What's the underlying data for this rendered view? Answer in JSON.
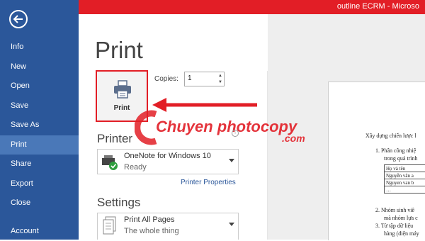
{
  "window": {
    "title": "outline ECRM -  Microso"
  },
  "sidebar": {
    "items": [
      {
        "label": "Info"
      },
      {
        "label": "New"
      },
      {
        "label": "Open"
      },
      {
        "label": "Save"
      },
      {
        "label": "Save As"
      },
      {
        "label": "Print",
        "active": true
      },
      {
        "label": "Share"
      },
      {
        "label": "Export"
      },
      {
        "label": "Close"
      },
      {
        "label": "Account"
      }
    ]
  },
  "main": {
    "title": "Print",
    "print_button_label": "Print",
    "copies_label": "Copies:",
    "copies_value": "1",
    "printer_section": "Printer",
    "printer": {
      "name": "OneNote for Windows 10",
      "status": "Ready"
    },
    "printer_properties": "Printer Properties",
    "settings_section": "Settings",
    "setting_pages": {
      "name": "Print All Pages",
      "desc": "The whole thing"
    }
  },
  "watermark": {
    "text": "Chuyen photocopy",
    "suffix": ".com"
  },
  "preview": {
    "lines": [
      "Xây dựng chiến lược l",
      "1.  Phân công nhiệ",
      "trong quá trình",
      "2.  Nhóm sinh viê",
      "mà nhóm lựa c",
      "3.  Từ tập dữ liệu",
      "hàng (điện máy"
    ],
    "table": [
      "Họ và tên",
      "Nguyễn văn a",
      "Nguyen van b",
      "…"
    ]
  },
  "colors": {
    "brand_blue": "#2b579a",
    "accent_red": "#e21e26"
  }
}
